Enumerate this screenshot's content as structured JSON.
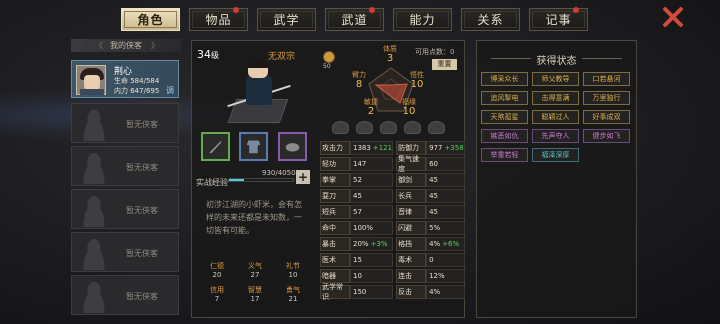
{
  "tabs": [
    {
      "label": "角色",
      "active": true,
      "dot": false
    },
    {
      "label": "物品",
      "active": false,
      "dot": true
    },
    {
      "label": "武学",
      "active": false,
      "dot": false
    },
    {
      "label": "武道",
      "active": false,
      "dot": true
    },
    {
      "label": "能力",
      "active": false,
      "dot": false
    },
    {
      "label": "关系",
      "active": false,
      "dot": false
    },
    {
      "label": "记事",
      "active": false,
      "dot": true
    }
  ],
  "roster": {
    "header": "我的侠客",
    "selected": {
      "name": "荆心",
      "hp": "生命 584/584",
      "mp": "内力 647/695",
      "tag": "调"
    },
    "empty_label": "暂无侠客",
    "empty_count": 5
  },
  "character": {
    "level": "34",
    "level_unit": "级",
    "sect": "无双宗",
    "exp_label": "实战经验",
    "exp_text": "930/4050",
    "exp_value": 930,
    "exp_max": 4050,
    "bio": "初涉江湖的小虾米，会有怎样的未来还都是未知数，一切皆有可能。",
    "virtues": [
      {
        "name": "仁德",
        "value": "20"
      },
      {
        "name": "义气",
        "value": "27"
      },
      {
        "name": "礼节",
        "value": "10"
      },
      {
        "name": "信用",
        "value": "7"
      },
      {
        "name": "智慧",
        "value": "17"
      },
      {
        "name": "勇气",
        "value": "21"
      }
    ],
    "coin_value": "50",
    "points_label": "可用点数：0",
    "reset_label": "重置",
    "attributes": [
      {
        "name": "体质",
        "value": "3"
      },
      {
        "name": "臂力",
        "value": "8"
      },
      {
        "name": "悟性",
        "value": "10"
      },
      {
        "name": "敏捷",
        "value": "2"
      },
      {
        "name": "福缘",
        "value": "10"
      }
    ],
    "stats": [
      {
        "k": "攻击力",
        "v": "1383",
        "up": "+121"
      },
      {
        "k": "防御力",
        "v": "977",
        "up": "+358"
      },
      {
        "k": "轻功",
        "v": "147",
        "up": ""
      },
      {
        "k": "集气速度",
        "v": "60",
        "up": ""
      },
      {
        "k": "拳掌",
        "v": "52",
        "up": ""
      },
      {
        "k": "御剑",
        "v": "45",
        "up": ""
      },
      {
        "k": "耍刀",
        "v": "45",
        "up": ""
      },
      {
        "k": "长兵",
        "v": "45",
        "up": ""
      },
      {
        "k": "短兵",
        "v": "57",
        "up": ""
      },
      {
        "k": "音律",
        "v": "45",
        "up": ""
      },
      {
        "k": "命中",
        "v": "100%",
        "up": ""
      },
      {
        "k": "闪避",
        "v": "5%",
        "up": ""
      },
      {
        "k": "暴击",
        "v": "20%",
        "up": "+3%"
      },
      {
        "k": "格挡",
        "v": "4%",
        "up": "+6%"
      },
      {
        "k": "医术",
        "v": "15",
        "up": ""
      },
      {
        "k": "毒术",
        "v": "0",
        "up": ""
      },
      {
        "k": "暗器",
        "v": "10",
        "up": ""
      },
      {
        "k": "连击",
        "v": "12%",
        "up": ""
      },
      {
        "k": "武学常识",
        "v": "150",
        "up": ""
      },
      {
        "k": "反击",
        "v": "4%",
        "up": ""
      }
    ]
  },
  "status_panel": {
    "title": "获得状态",
    "chips": [
      {
        "label": "博采众长",
        "tone": "gold"
      },
      {
        "label": "师父教导",
        "tone": "gold"
      },
      {
        "label": "口若悬河",
        "tone": "gold"
      },
      {
        "label": "追风掣电",
        "tone": "gold"
      },
      {
        "label": "击得意满",
        "tone": "gold"
      },
      {
        "label": "万里独行",
        "tone": "gold"
      },
      {
        "label": "天煞孤星",
        "tone": "gold"
      },
      {
        "label": "聪颖过人",
        "tone": "gold"
      },
      {
        "label": "好事成双",
        "tone": "gold"
      },
      {
        "label": "嫉恶如仇",
        "tone": "purple"
      },
      {
        "label": "先声夺人",
        "tone": "purple"
      },
      {
        "label": "健步如飞",
        "tone": "purple"
      },
      {
        "label": "举重若轻",
        "tone": "purple"
      },
      {
        "label": "福泽深厚",
        "tone": "blue"
      }
    ]
  },
  "colors": {
    "accent_gold": "#d99a3e",
    "exp_bar": "#4cd0d6",
    "close": "#d24a3c",
    "bonus_green": "#58d158"
  }
}
